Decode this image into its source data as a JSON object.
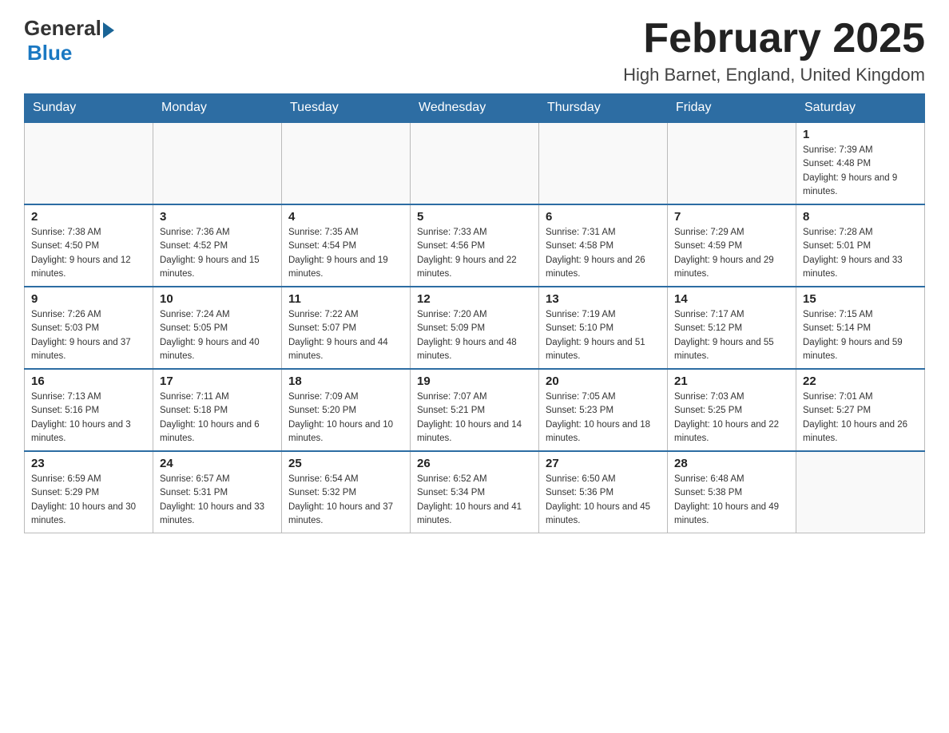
{
  "header": {
    "logo_general": "General",
    "logo_blue": "Blue",
    "month_title": "February 2025",
    "location": "High Barnet, England, United Kingdom"
  },
  "days_of_week": [
    "Sunday",
    "Monday",
    "Tuesday",
    "Wednesday",
    "Thursday",
    "Friday",
    "Saturday"
  ],
  "weeks": [
    {
      "days": [
        {
          "number": "",
          "sunrise": "",
          "sunset": "",
          "daylight": "",
          "empty": true
        },
        {
          "number": "",
          "sunrise": "",
          "sunset": "",
          "daylight": "",
          "empty": true
        },
        {
          "number": "",
          "sunrise": "",
          "sunset": "",
          "daylight": "",
          "empty": true
        },
        {
          "number": "",
          "sunrise": "",
          "sunset": "",
          "daylight": "",
          "empty": true
        },
        {
          "number": "",
          "sunrise": "",
          "sunset": "",
          "daylight": "",
          "empty": true
        },
        {
          "number": "",
          "sunrise": "",
          "sunset": "",
          "daylight": "",
          "empty": true
        },
        {
          "number": "1",
          "sunrise": "Sunrise: 7:39 AM",
          "sunset": "Sunset: 4:48 PM",
          "daylight": "Daylight: 9 hours and 9 minutes.",
          "empty": false
        }
      ]
    },
    {
      "days": [
        {
          "number": "2",
          "sunrise": "Sunrise: 7:38 AM",
          "sunset": "Sunset: 4:50 PM",
          "daylight": "Daylight: 9 hours and 12 minutes.",
          "empty": false
        },
        {
          "number": "3",
          "sunrise": "Sunrise: 7:36 AM",
          "sunset": "Sunset: 4:52 PM",
          "daylight": "Daylight: 9 hours and 15 minutes.",
          "empty": false
        },
        {
          "number": "4",
          "sunrise": "Sunrise: 7:35 AM",
          "sunset": "Sunset: 4:54 PM",
          "daylight": "Daylight: 9 hours and 19 minutes.",
          "empty": false
        },
        {
          "number": "5",
          "sunrise": "Sunrise: 7:33 AM",
          "sunset": "Sunset: 4:56 PM",
          "daylight": "Daylight: 9 hours and 22 minutes.",
          "empty": false
        },
        {
          "number": "6",
          "sunrise": "Sunrise: 7:31 AM",
          "sunset": "Sunset: 4:58 PM",
          "daylight": "Daylight: 9 hours and 26 minutes.",
          "empty": false
        },
        {
          "number": "7",
          "sunrise": "Sunrise: 7:29 AM",
          "sunset": "Sunset: 4:59 PM",
          "daylight": "Daylight: 9 hours and 29 minutes.",
          "empty": false
        },
        {
          "number": "8",
          "sunrise": "Sunrise: 7:28 AM",
          "sunset": "Sunset: 5:01 PM",
          "daylight": "Daylight: 9 hours and 33 minutes.",
          "empty": false
        }
      ]
    },
    {
      "days": [
        {
          "number": "9",
          "sunrise": "Sunrise: 7:26 AM",
          "sunset": "Sunset: 5:03 PM",
          "daylight": "Daylight: 9 hours and 37 minutes.",
          "empty": false
        },
        {
          "number": "10",
          "sunrise": "Sunrise: 7:24 AM",
          "sunset": "Sunset: 5:05 PM",
          "daylight": "Daylight: 9 hours and 40 minutes.",
          "empty": false
        },
        {
          "number": "11",
          "sunrise": "Sunrise: 7:22 AM",
          "sunset": "Sunset: 5:07 PM",
          "daylight": "Daylight: 9 hours and 44 minutes.",
          "empty": false
        },
        {
          "number": "12",
          "sunrise": "Sunrise: 7:20 AM",
          "sunset": "Sunset: 5:09 PM",
          "daylight": "Daylight: 9 hours and 48 minutes.",
          "empty": false
        },
        {
          "number": "13",
          "sunrise": "Sunrise: 7:19 AM",
          "sunset": "Sunset: 5:10 PM",
          "daylight": "Daylight: 9 hours and 51 minutes.",
          "empty": false
        },
        {
          "number": "14",
          "sunrise": "Sunrise: 7:17 AM",
          "sunset": "Sunset: 5:12 PM",
          "daylight": "Daylight: 9 hours and 55 minutes.",
          "empty": false
        },
        {
          "number": "15",
          "sunrise": "Sunrise: 7:15 AM",
          "sunset": "Sunset: 5:14 PM",
          "daylight": "Daylight: 9 hours and 59 minutes.",
          "empty": false
        }
      ]
    },
    {
      "days": [
        {
          "number": "16",
          "sunrise": "Sunrise: 7:13 AM",
          "sunset": "Sunset: 5:16 PM",
          "daylight": "Daylight: 10 hours and 3 minutes.",
          "empty": false
        },
        {
          "number": "17",
          "sunrise": "Sunrise: 7:11 AM",
          "sunset": "Sunset: 5:18 PM",
          "daylight": "Daylight: 10 hours and 6 minutes.",
          "empty": false
        },
        {
          "number": "18",
          "sunrise": "Sunrise: 7:09 AM",
          "sunset": "Sunset: 5:20 PM",
          "daylight": "Daylight: 10 hours and 10 minutes.",
          "empty": false
        },
        {
          "number": "19",
          "sunrise": "Sunrise: 7:07 AM",
          "sunset": "Sunset: 5:21 PM",
          "daylight": "Daylight: 10 hours and 14 minutes.",
          "empty": false
        },
        {
          "number": "20",
          "sunrise": "Sunrise: 7:05 AM",
          "sunset": "Sunset: 5:23 PM",
          "daylight": "Daylight: 10 hours and 18 minutes.",
          "empty": false
        },
        {
          "number": "21",
          "sunrise": "Sunrise: 7:03 AM",
          "sunset": "Sunset: 5:25 PM",
          "daylight": "Daylight: 10 hours and 22 minutes.",
          "empty": false
        },
        {
          "number": "22",
          "sunrise": "Sunrise: 7:01 AM",
          "sunset": "Sunset: 5:27 PM",
          "daylight": "Daylight: 10 hours and 26 minutes.",
          "empty": false
        }
      ]
    },
    {
      "days": [
        {
          "number": "23",
          "sunrise": "Sunrise: 6:59 AM",
          "sunset": "Sunset: 5:29 PM",
          "daylight": "Daylight: 10 hours and 30 minutes.",
          "empty": false
        },
        {
          "number": "24",
          "sunrise": "Sunrise: 6:57 AM",
          "sunset": "Sunset: 5:31 PM",
          "daylight": "Daylight: 10 hours and 33 minutes.",
          "empty": false
        },
        {
          "number": "25",
          "sunrise": "Sunrise: 6:54 AM",
          "sunset": "Sunset: 5:32 PM",
          "daylight": "Daylight: 10 hours and 37 minutes.",
          "empty": false
        },
        {
          "number": "26",
          "sunrise": "Sunrise: 6:52 AM",
          "sunset": "Sunset: 5:34 PM",
          "daylight": "Daylight: 10 hours and 41 minutes.",
          "empty": false
        },
        {
          "number": "27",
          "sunrise": "Sunrise: 6:50 AM",
          "sunset": "Sunset: 5:36 PM",
          "daylight": "Daylight: 10 hours and 45 minutes.",
          "empty": false
        },
        {
          "number": "28",
          "sunrise": "Sunrise: 6:48 AM",
          "sunset": "Sunset: 5:38 PM",
          "daylight": "Daylight: 10 hours and 49 minutes.",
          "empty": false
        },
        {
          "number": "",
          "sunrise": "",
          "sunset": "",
          "daylight": "",
          "empty": true
        }
      ]
    }
  ]
}
